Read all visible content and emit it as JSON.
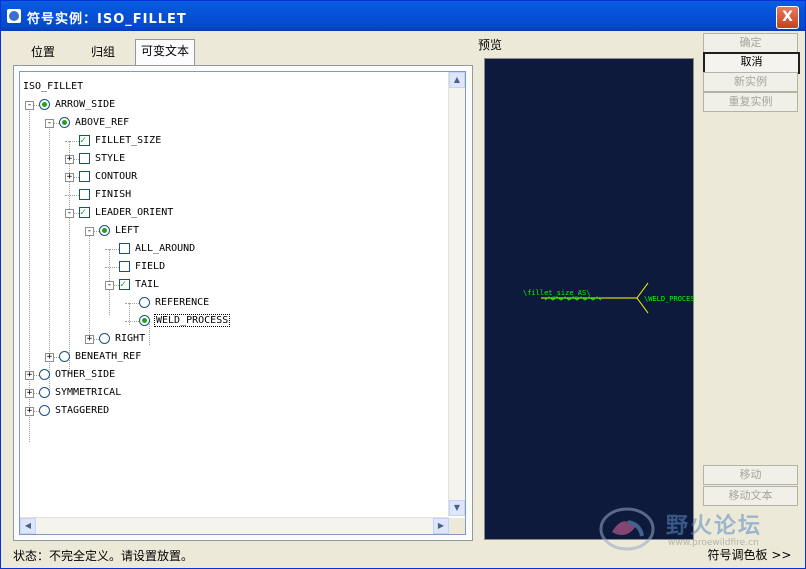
{
  "window": {
    "title": "符号实例：ISO_FILLET",
    "close_label": "X"
  },
  "tabs": [
    {
      "label": "位置",
      "active": false
    },
    {
      "label": "归组",
      "active": false
    },
    {
      "label": "可变文本",
      "active": true
    }
  ],
  "tree": {
    "root": "ISO_FILLET",
    "nodes": [
      {
        "label": "ARROW_SIDE",
        "control": "radio",
        "checked": true,
        "expander": "-"
      },
      {
        "label": "ABOVE_REF",
        "control": "radio",
        "checked": true,
        "expander": "-"
      },
      {
        "label": "FILLET_SIZE",
        "control": "checkbox",
        "checked": true,
        "expander": ""
      },
      {
        "label": "STYLE",
        "control": "checkbox",
        "checked": false,
        "expander": "+"
      },
      {
        "label": "CONTOUR",
        "control": "checkbox",
        "checked": false,
        "expander": "+"
      },
      {
        "label": "FINISH",
        "control": "checkbox",
        "checked": false,
        "expander": ""
      },
      {
        "label": "LEADER_ORIENT",
        "control": "checkbox",
        "checked": true,
        "expander": "-"
      },
      {
        "label": "LEFT",
        "control": "radio",
        "checked": true,
        "expander": "-"
      },
      {
        "label": "ALL_AROUND",
        "control": "checkbox",
        "checked": false,
        "expander": ""
      },
      {
        "label": "FIELD",
        "control": "checkbox",
        "checked": false,
        "expander": ""
      },
      {
        "label": "TAIL",
        "control": "checkbox",
        "checked": true,
        "expander": "-"
      },
      {
        "label": "REFERENCE",
        "control": "radio",
        "checked": false,
        "expander": ""
      },
      {
        "label": "WELD_PROCESS",
        "control": "radio",
        "checked": true,
        "expander": ""
      },
      {
        "label": "RIGHT",
        "control": "radio",
        "checked": false,
        "expander": "+"
      },
      {
        "label": "BENEATH_REF",
        "control": "radio",
        "checked": false,
        "expander": "+"
      },
      {
        "label": "OTHER_SIDE",
        "control": "radio",
        "checked": false,
        "expander": "+"
      },
      {
        "label": "SYMMETRICAL",
        "control": "radio",
        "checked": false,
        "expander": "+"
      },
      {
        "label": "STAGGERED",
        "control": "radio",
        "checked": false,
        "expander": "+"
      }
    ]
  },
  "preview": {
    "label": "预览",
    "left_text": "\\fillet_size_AS\\",
    "right_text": "\\WELD_PROCES",
    "line_color": "#ffff00",
    "text_color": "#00ff00"
  },
  "buttons": {
    "ok": "确定",
    "cancel": "取消",
    "new_instance": "新实例",
    "restore_instance": "重复实例",
    "move": "移动",
    "move_text": "移动文本",
    "palette": "符号调色板 >>"
  },
  "status": "状态：不完全定义。请设置放置。",
  "watermark": {
    "text": "野火论坛",
    "sub": "www.proewildfire.cn"
  }
}
